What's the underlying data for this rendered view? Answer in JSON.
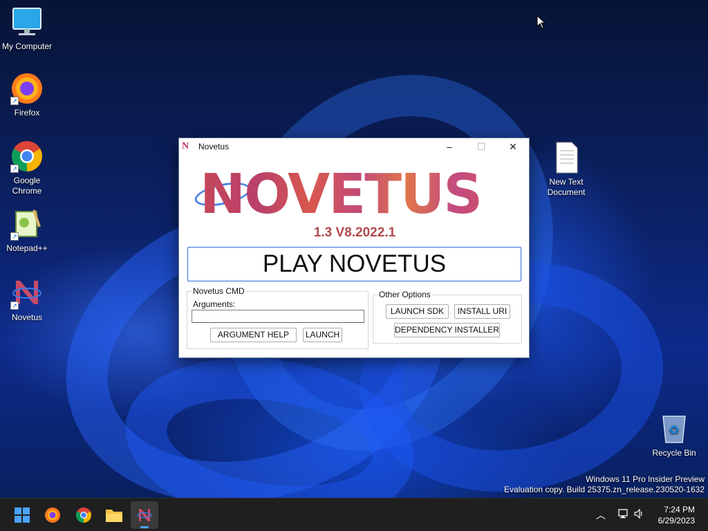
{
  "desktop": {
    "icons": [
      {
        "label": "My Computer",
        "icon": "monitor-icon"
      },
      {
        "label": "Firefox",
        "icon": "firefox-icon"
      },
      {
        "label": "Google Chrome",
        "icon": "chrome-icon"
      },
      {
        "label": "Notepad++",
        "icon": "notepadpp-icon"
      },
      {
        "label": "Novetus",
        "icon": "novetus-icon"
      },
      {
        "label": "New Text Document",
        "icon": "text-document-icon"
      },
      {
        "label": "Recycle Bin",
        "icon": "recycle-bin-icon"
      }
    ],
    "watermark": {
      "line1": "Windows 11 Pro Insider Preview",
      "line2": "Evaluation copy. Build 25375.zn_release.230520-1632"
    }
  },
  "window": {
    "title": "Novetus",
    "logo_text": "NOVETUS",
    "version": "1.3 V8.2022.1",
    "play_button": "PLAY NOVETUS",
    "cmd_group": {
      "legend": "Novetus CMD",
      "arguments_label": "Arguments:",
      "arguments_value": "",
      "argument_help_button": "ARGUMENT HELP",
      "launch_button": "LAUNCH"
    },
    "options_group": {
      "legend": "Other Options",
      "launch_sdk_button": "LAUNCH SDK",
      "install_uri_button": "INSTALL URI",
      "dependency_installer_button": "DEPENDENCY INSTALLER"
    },
    "controls": {
      "minimize": "–",
      "maximize": "☐",
      "close": "✕"
    }
  },
  "taskbar": {
    "items": [
      "start-icon",
      "firefox-icon",
      "chrome-icon",
      "file-explorer-icon",
      "novetus-icon"
    ],
    "active_item": "novetus-icon",
    "time": "7:24 PM",
    "date": "6/29/2023"
  },
  "colors": {
    "accent": "#2d6ad6",
    "logo": "#c7475a",
    "version": "#b24a4f",
    "taskbar": "#1f1f1f"
  }
}
